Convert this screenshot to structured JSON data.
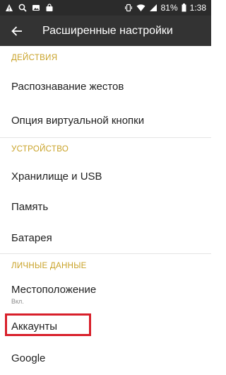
{
  "status_bar": {
    "battery": "81%",
    "time": "1:38"
  },
  "app_bar": {
    "title": "Расширенные настройки"
  },
  "sections": [
    {
      "header": "ДЕЙСТВИЯ",
      "items": [
        {
          "label": "Распознавание жестов"
        },
        {
          "label": "Опция виртуальной кнопки"
        }
      ]
    },
    {
      "header": "УСТРОЙСТВО",
      "items": [
        {
          "label": "Хранилище и USB"
        },
        {
          "label": "Память"
        },
        {
          "label": "Батарея"
        }
      ]
    },
    {
      "header": "ЛИЧНЫЕ ДАННЫЕ",
      "items": [
        {
          "label": "Местоположение",
          "sublabel": "Вкл."
        },
        {
          "label": "Аккаунты",
          "highlighted": true
        },
        {
          "label": "Google"
        }
      ]
    }
  ],
  "colors": {
    "accent": "#c9a227",
    "highlight": "#d81f2a",
    "app_bar": "#333333"
  }
}
